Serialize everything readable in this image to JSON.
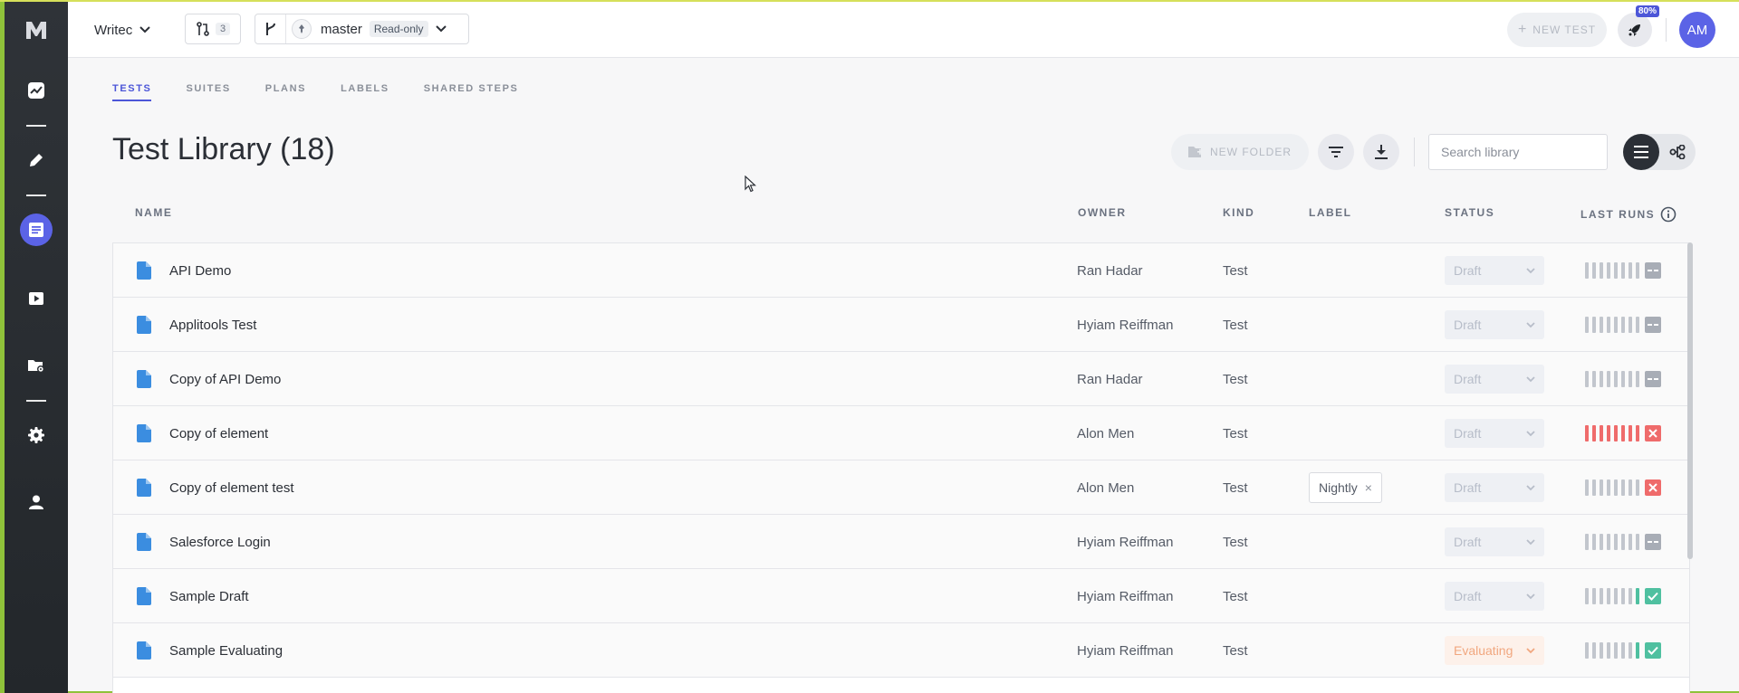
{
  "colors": {
    "accent": "#5b63e6",
    "rail_bg": "#2b2f34",
    "failed": "#ef6b6b",
    "passed": "#4fc0a0"
  },
  "rail": {
    "logo": "M",
    "items": [
      {
        "name": "insights",
        "icon": "trend-icon"
      },
      {
        "name": "create",
        "icon": "pencil-icon"
      },
      {
        "name": "library",
        "icon": "document-list-icon",
        "active": true
      },
      {
        "name": "runs",
        "icon": "play-icon"
      },
      {
        "name": "file-settings",
        "icon": "folder-gear-icon"
      },
      {
        "name": "settings",
        "icon": "gear-icon"
      },
      {
        "name": "profile",
        "icon": "user-icon"
      }
    ]
  },
  "topbar": {
    "project": "Writec",
    "pull_requests_count": "3",
    "branch": "master",
    "branch_mode": "Read-only",
    "new_test_label": "NEW TEST",
    "rocket_badge": "80%",
    "avatar_initials": "AM"
  },
  "tabs": [
    {
      "label": "TESTS",
      "active": true
    },
    {
      "label": "SUITES"
    },
    {
      "label": "PLANS"
    },
    {
      "label": "LABELS"
    },
    {
      "label": "SHARED STEPS"
    }
  ],
  "page": {
    "title": "Test Library (18)",
    "new_folder_label": "NEW FOLDER",
    "search_placeholder": "Search library"
  },
  "table": {
    "headers": {
      "name": "NAME",
      "owner": "OWNER",
      "kind": "KIND",
      "label": "LABEL",
      "status": "STATUS",
      "last_runs": "LAST RUNS"
    },
    "rows": [
      {
        "name": "API Demo",
        "owner": "Ran Hadar",
        "kind": "Test",
        "label": "",
        "status": "Draft",
        "runs": "none"
      },
      {
        "name": "Applitools Test",
        "owner": "Hyiam Reiffman",
        "kind": "Test",
        "label": "",
        "status": "Draft",
        "runs": "none"
      },
      {
        "name": "Copy of API Demo",
        "owner": "Ran Hadar",
        "kind": "Test",
        "label": "",
        "status": "Draft",
        "runs": "none"
      },
      {
        "name": "Copy of element",
        "owner": "Alon Men",
        "kind": "Test",
        "label": "",
        "status": "Draft",
        "runs": "fail-all"
      },
      {
        "name": "Copy of element test",
        "owner": "Alon Men",
        "kind": "Test",
        "label": "Nightly",
        "status": "Draft",
        "runs": "fail-last"
      },
      {
        "name": "Salesforce Login",
        "owner": "Hyiam Reiffman",
        "kind": "Test",
        "label": "",
        "status": "Draft",
        "runs": "none"
      },
      {
        "name": "Sample Draft",
        "owner": "Hyiam Reiffman",
        "kind": "Test",
        "label": "",
        "status": "Draft",
        "runs": "pass-last"
      },
      {
        "name": "Sample Evaluating",
        "owner": "Hyiam Reiffman",
        "kind": "Test",
        "label": "",
        "status": "Evaluating",
        "runs": "pass-last"
      }
    ]
  }
}
